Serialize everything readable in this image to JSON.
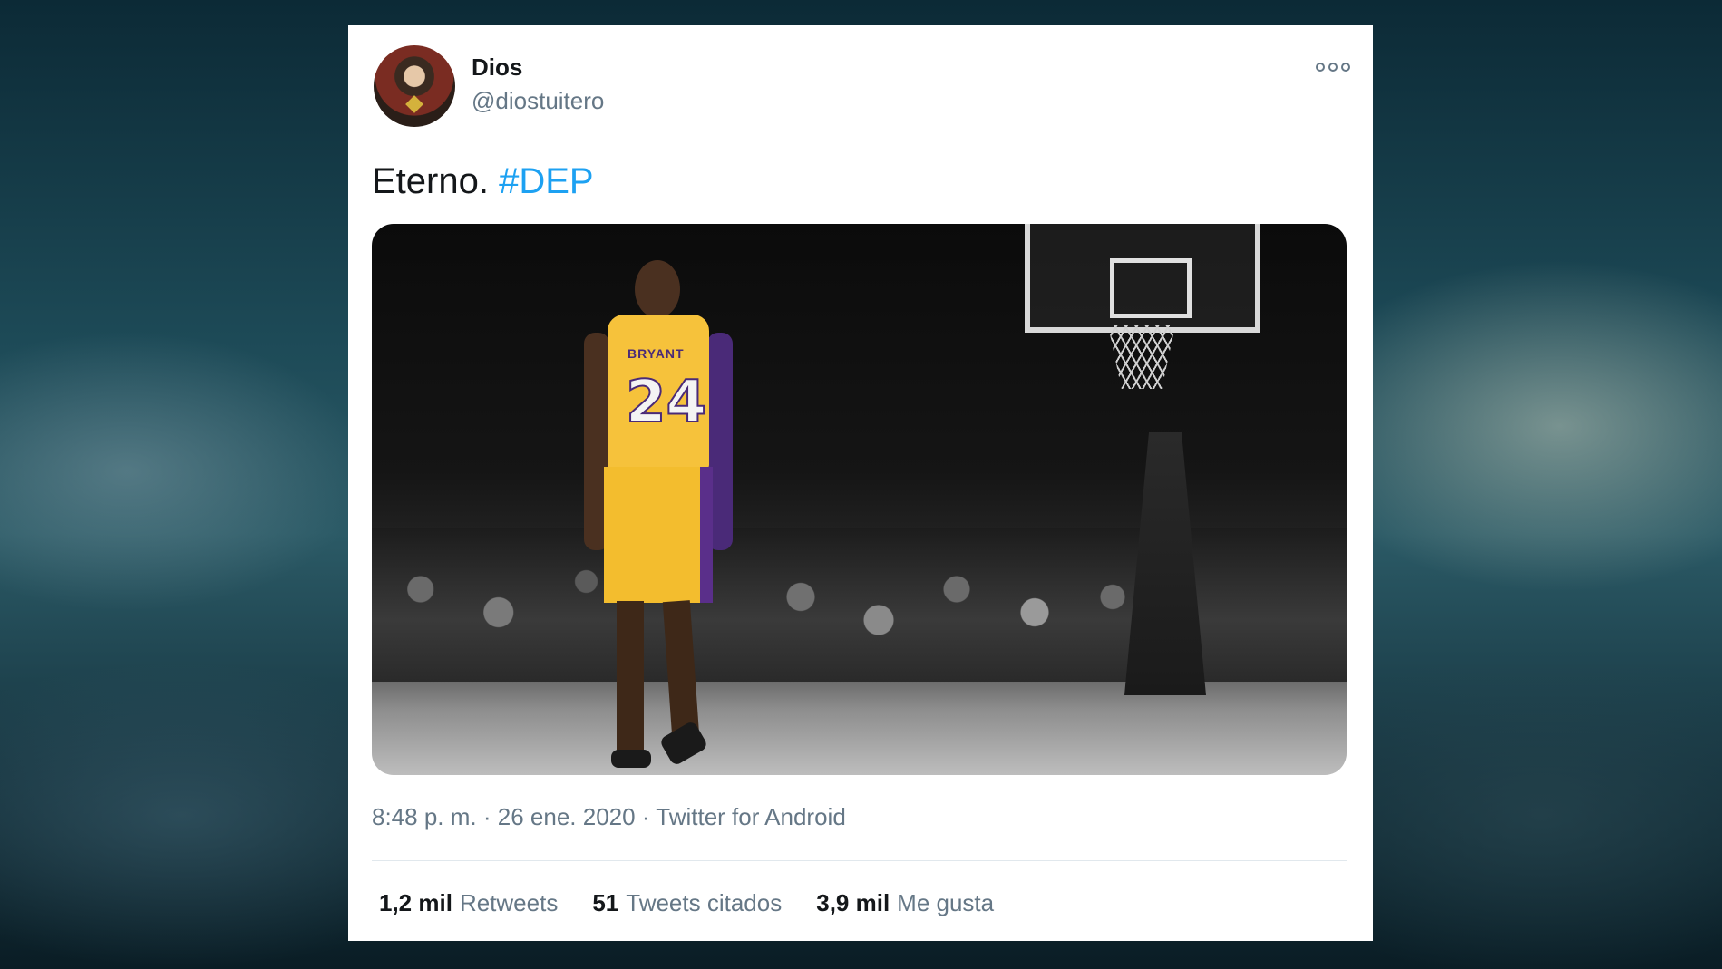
{
  "tweet": {
    "author_name": "Dios",
    "author_handle": "@diostuitero",
    "text": "Eterno.",
    "hashtag": "#DEP",
    "more_icon": "more-options-icon",
    "image_alt": "Kobe Bryant 24 walking on court",
    "jersey_name": "BRYANT",
    "jersey_number": "24",
    "time": "8:48 p. m.",
    "separator": "·",
    "date": "26 ene. 2020",
    "source": "Twitter for Android",
    "stats": {
      "retweets_count": "1,2 mil",
      "retweets_label": "Retweets",
      "quotes_count": "51",
      "quotes_label": "Tweets citados",
      "likes_count": "3,9 mil",
      "likes_label": "Me gusta"
    }
  },
  "colors": {
    "link": "#1da1f2",
    "secondary_text": "#657786",
    "primary_text": "#14171a",
    "jersey_gold": "#f6c23b",
    "jersey_purple": "#4a2a78"
  }
}
